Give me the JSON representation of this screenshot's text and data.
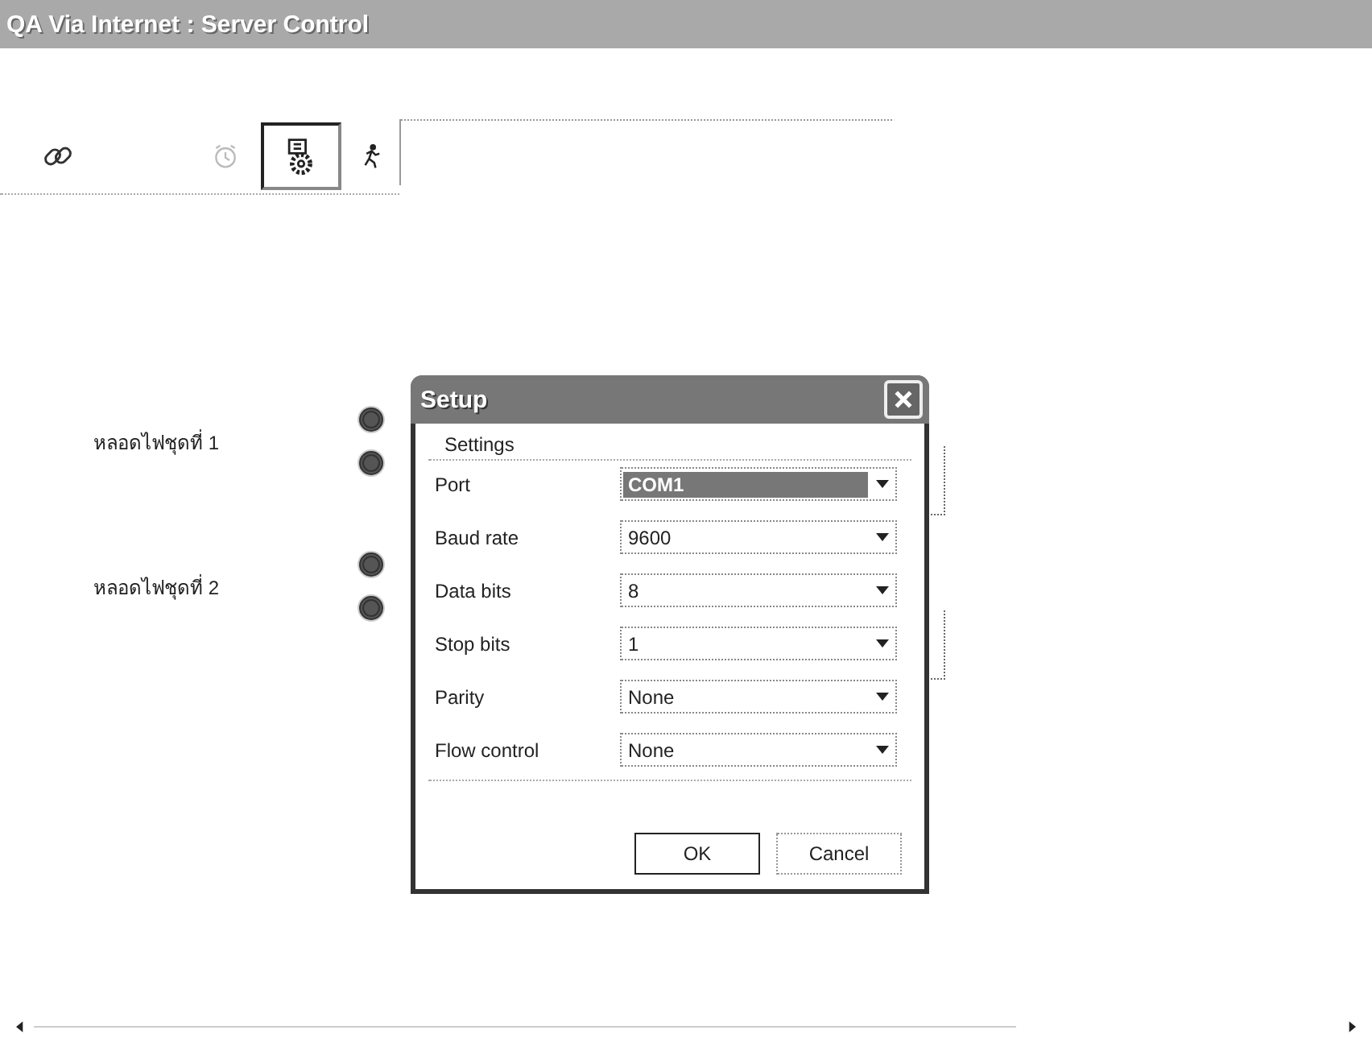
{
  "window": {
    "title": "QA Via Internet : Server Control"
  },
  "toolbar": [
    {
      "kind": "link",
      "selected": false
    },
    {
      "kind": "clock",
      "selected": false
    },
    {
      "kind": "setup",
      "selected": true
    },
    {
      "kind": "exit",
      "selected": false
    }
  ],
  "lamp_groups": [
    {
      "label": "หลอดไฟชุดที่ 1",
      "switches": [
        {
          "on": false
        },
        {
          "on": false
        }
      ]
    },
    {
      "label": "หลอดไฟชุดที่ 2",
      "switches": [
        {
          "on": false
        },
        {
          "on": false
        }
      ]
    }
  ],
  "dialog": {
    "title": "Setup",
    "group_label": "Settings",
    "fields": [
      {
        "label": "Port",
        "value": "COM1",
        "selected": true
      },
      {
        "label": "Baud rate",
        "value": "9600",
        "selected": false
      },
      {
        "label": "Data bits",
        "value": "8",
        "selected": false
      },
      {
        "label": "Stop bits",
        "value": "1",
        "selected": false
      },
      {
        "label": "Parity",
        "value": "None",
        "selected": false
      },
      {
        "label": "Flow control",
        "value": "None",
        "selected": false
      }
    ],
    "buttons": [
      {
        "label": "OK",
        "default": true
      },
      {
        "label": "Cancel",
        "default": false
      }
    ]
  }
}
